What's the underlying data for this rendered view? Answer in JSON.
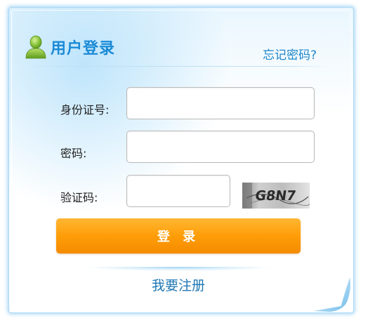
{
  "header": {
    "title": "用户登录",
    "forgot_password": "忘记密码?"
  },
  "form": {
    "id_label": "身份证号:",
    "id_value": "",
    "id_placeholder": "",
    "password_label": "密码:",
    "password_value": "",
    "password_placeholder": "",
    "captcha_label": "验证码:",
    "captcha_value": "",
    "captcha_placeholder": "",
    "captcha_image_text": "G8N7"
  },
  "actions": {
    "login_label": "登 录",
    "register_label": "我要注册"
  },
  "colors": {
    "accent_blue": "#1a8ad7",
    "link_blue": "#1e86c9",
    "button_orange": "#ff9d08",
    "card_border": "#a9d8f5"
  },
  "icons": {
    "header_icon": "user-icon",
    "captcha": "captcha-image"
  }
}
